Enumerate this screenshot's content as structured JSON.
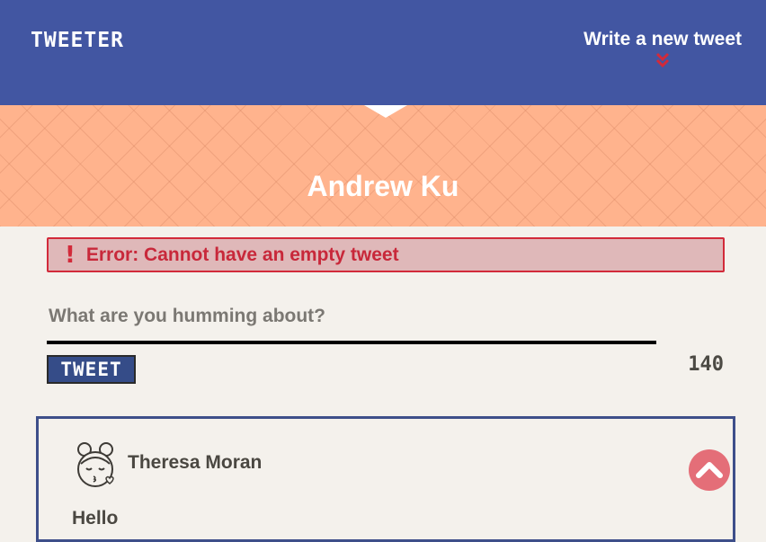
{
  "nav": {
    "brand": "TWEETER",
    "compose_label": "Write a new tweet",
    "accent_color": "#d22a3a"
  },
  "profile": {
    "name": "Andrew Ku"
  },
  "error": {
    "icon": "!",
    "message": "Error: Cannot have an empty tweet"
  },
  "composer": {
    "placeholder": "What are you humming about?",
    "value": "",
    "submit_label": "TWEET",
    "char_count": "140"
  },
  "tweets": [
    {
      "author": "Theresa Moran",
      "avatar_icon": "girl-avatar-icon",
      "body": "Hello"
    }
  ],
  "colors": {
    "nav_bg": "#4256a2",
    "banner_bg": "#ffb38d",
    "page_bg": "#f4f1ec",
    "error_bg": "#dfb8b9",
    "error_text": "#c8283a",
    "scroll_button": "#e46e78"
  }
}
